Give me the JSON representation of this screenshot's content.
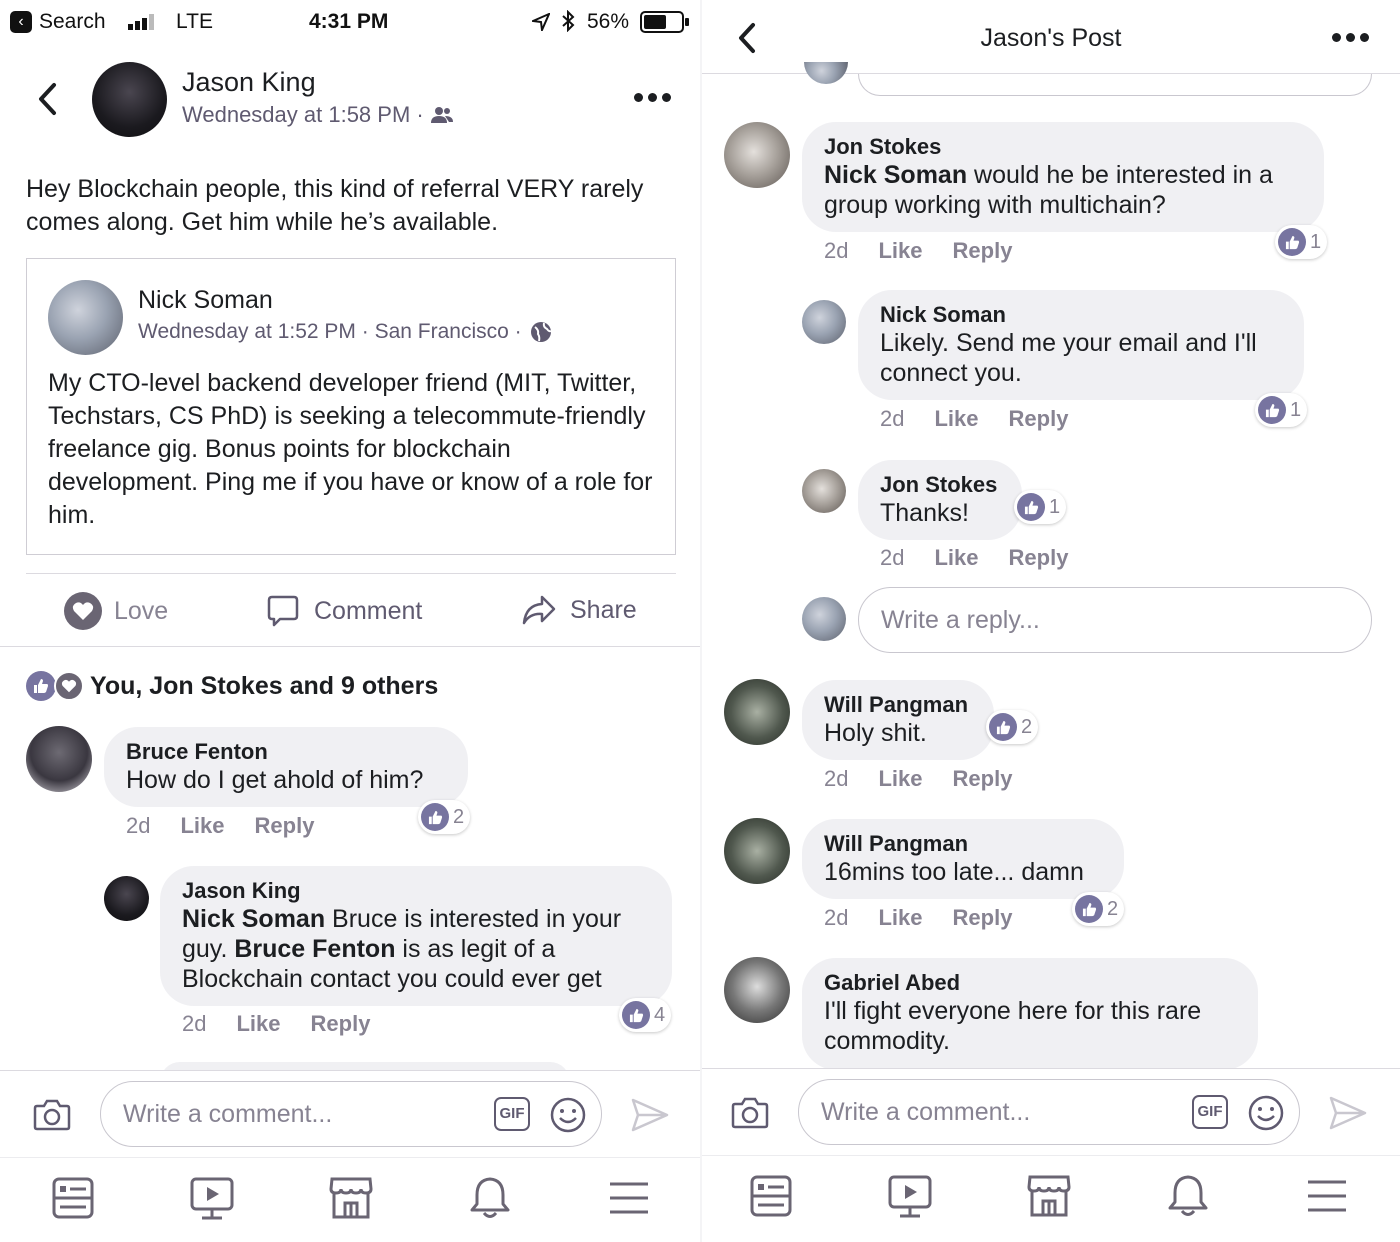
{
  "status_bar": {
    "back_app": "Search",
    "network": "LTE",
    "time": "4:31 PM",
    "battery": "56%"
  },
  "left": {
    "post": {
      "author": "Jason King",
      "timestamp": "Wednesday at 1:58 PM ·",
      "text": "Hey Blockchain people, this kind of referral VERY rarely comes along. Get him while he’s available.",
      "shared": {
        "author": "Nick Soman",
        "meta": "Wednesday at 1:52 PM · San Francisco ·",
        "text": "My CTO-level backend developer friend (MIT, Twitter, Techstars, CS PhD) is seeking a telecommute-friendly freelance gig. Bonus points for blockchain development. Ping me if you have or know of a role for him."
      }
    },
    "action_bar": {
      "love": "Love",
      "comment": "Comment",
      "share": "Share"
    },
    "reactions_summary": "You, Jon Stokes and 9 others",
    "comments": [
      {
        "name": "Bruce Fenton",
        "text": "How do I get ahold of him?",
        "time": "2d",
        "like": "Like",
        "reply": "Reply",
        "reactions": "2"
      },
      {
        "name": "Jason King",
        "mention1": "Nick Soman",
        "text1": " Bruce is interested in your guy. ",
        "mention2": "Bruce Fenton",
        "text2": " is as legit of a Blockchain contact you could ever get",
        "time": "2d",
        "like": "Like",
        "reply": "Reply",
        "reactions": "4"
      }
    ],
    "composer": {
      "placeholder": "Write a comment...",
      "gif": "GIF"
    }
  },
  "right": {
    "header": {
      "title": "Jason's Post"
    },
    "comments": [
      {
        "name": "Jon Stokes",
        "mention": "Nick Soman",
        "text": " would he be interested in a group working with multichain?",
        "time": "2d",
        "like": "Like",
        "reply": "Reply",
        "reactions": "1"
      },
      {
        "name": "Nick Soman",
        "text": "Likely. Send me your email and I'll connect you.",
        "time": "2d",
        "like": "Like",
        "reply": "Reply",
        "reactions": "1"
      },
      {
        "name": "Jon Stokes",
        "text": "Thanks!",
        "time": "2d",
        "like": "Like",
        "reply": "Reply",
        "reactions": "1"
      },
      {
        "name": "Will Pangman",
        "text": "Holy shit.",
        "time": "2d",
        "like": "Like",
        "reply": "Reply",
        "reactions": "2"
      },
      {
        "name": "Will Pangman",
        "text": "16mins too late... damn",
        "time": "2d",
        "like": "Like",
        "reply": "Reply",
        "reactions": "2"
      },
      {
        "name": "Gabriel Abed",
        "text": "I'll fight everyone here for this rare commodity."
      }
    ],
    "reply_placeholder": "Write a reply...",
    "composer": {
      "placeholder": "Write a comment...",
      "gif": "GIF"
    }
  },
  "tab_bar": [
    "news-feed",
    "watch",
    "marketplace",
    "notifications",
    "menu"
  ]
}
